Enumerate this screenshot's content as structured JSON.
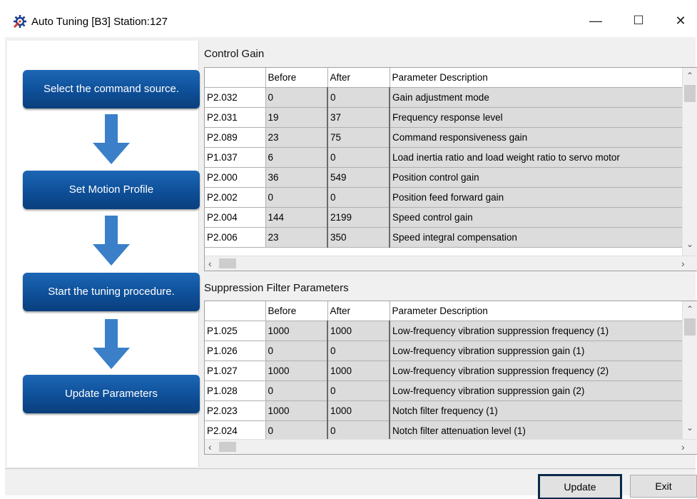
{
  "window": {
    "title": "Auto Tuning [B3] Station:127",
    "minimize_glyph": "—",
    "maximize_glyph": "☐",
    "close_glyph": "✕"
  },
  "steps": [
    {
      "label": "Select the command source."
    },
    {
      "label": "Set Motion Profile"
    },
    {
      "label": "Start the tuning procedure."
    },
    {
      "label": "Update Parameters"
    }
  ],
  "control_gain": {
    "title": "Control Gain",
    "headers": [
      "",
      "Before",
      "After",
      "Parameter Description"
    ],
    "rows": [
      {
        "param": "P2.032",
        "before": "0",
        "after": "0",
        "desc": "Gain adjustment mode"
      },
      {
        "param": "P2.031",
        "before": "19",
        "after": "37",
        "desc": "Frequency response level"
      },
      {
        "param": "P2.089",
        "before": "23",
        "after": "75",
        "desc": "Command responsiveness gain"
      },
      {
        "param": "P1.037",
        "before": "6",
        "after": "0",
        "desc": "Load inertia ratio and load weight ratio to servo motor"
      },
      {
        "param": "P2.000",
        "before": "36",
        "after": "549",
        "desc": "Position control gain"
      },
      {
        "param": "P2.002",
        "before": "0",
        "after": "0",
        "desc": "Position feed forward gain"
      },
      {
        "param": "P2.004",
        "before": "144",
        "after": "2199",
        "desc": "Speed control gain"
      },
      {
        "param": "P2.006",
        "before": "23",
        "after": "350",
        "desc": "Speed integral compensation"
      }
    ]
  },
  "suppression": {
    "title": "Suppression Filter Parameters",
    "headers": [
      "",
      "Before",
      "After",
      "Parameter Description"
    ],
    "rows": [
      {
        "param": "P1.025",
        "before": "1000",
        "after": "1000",
        "desc": "Low-frequency vibration suppression frequency (1)"
      },
      {
        "param": "P1.026",
        "before": "0",
        "after": "0",
        "desc": "Low-frequency vibration suppression gain (1)"
      },
      {
        "param": "P1.027",
        "before": "1000",
        "after": "1000",
        "desc": "Low-frequency vibration suppression frequency (2)"
      },
      {
        "param": "P1.028",
        "before": "0",
        "after": "0",
        "desc": "Low-frequency vibration suppression gain (2)"
      },
      {
        "param": "P2.023",
        "before": "1000",
        "after": "1000",
        "desc": "Notch filter frequency (1)"
      },
      {
        "param": "P2.024",
        "before": "0",
        "after": "0",
        "desc": "Notch filter attenuation level (1)"
      }
    ]
  },
  "buttons": {
    "update": "Update",
    "exit": "Exit"
  },
  "colors": {
    "step_blue": "#0e4f98",
    "arrow_blue": "#3a7fc8"
  }
}
